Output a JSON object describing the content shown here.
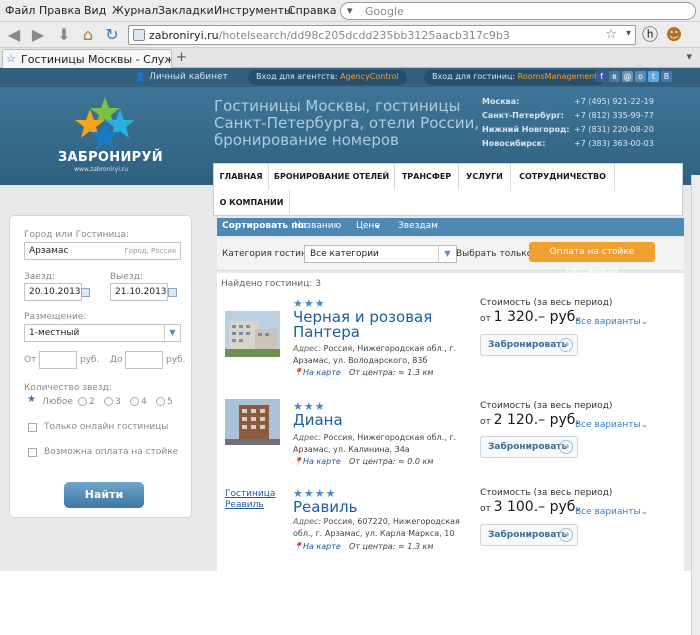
{
  "browser": {
    "menu": [
      "Файл",
      "Правка",
      "Вид",
      "Журнал",
      "Закладки",
      "Инструменты",
      "Справка"
    ],
    "search_placeholder": "Google",
    "url_domain": "zabroniryi.ru",
    "url_path": "/hotelsearch/dd98c205dcdd235bb3125aacb317c9b3",
    "tab_title": "Гостиницы Москвы - Служба б..."
  },
  "site": {
    "personal_cabinet": "Личный кабинет",
    "agents_label": "Вход для агентств:",
    "agents_link": "AgencyControl",
    "hotels_label": "Вход для гостиниц:",
    "hotels_link": "RoomsManagement",
    "brand": "ЗАБРОНИРУЙ",
    "brand_url": "www.zabroniryi.ru",
    "slogan": "Гостиницы Москвы, гостиницы Санкт-Петербурга, отели России, бронирование номеров",
    "phones": [
      {
        "city": "Москва:",
        "number": "+7 (495) 921-22-19"
      },
      {
        "city": "Санкт-Петербург:",
        "number": "+7 (812) 335-99-77"
      },
      {
        "city": "Нижний Новгород:",
        "number": "+7 (831) 220-08-20"
      },
      {
        "city": "Новосибирск:",
        "number": "+7 (383) 363-00-03"
      }
    ],
    "nav": [
      "ГЛАВНАЯ",
      "БРОНИРОВАНИЕ ОТЕЛЕЙ",
      "ТРАНСФЕР",
      "УСЛУГИ",
      "СОТРУДНИЧЕСТВО",
      "О КОМПАНИИ"
    ]
  },
  "sort": {
    "label": "Сортировать по:",
    "by_name": "Названию",
    "by_price": "Цене",
    "by_stars": "Звездам"
  },
  "filter": {
    "category_label": "Категория гостиниц:",
    "category_value": "Все категории",
    "only_label": "Выбрать только:",
    "pay_button": "Оплата на стойке гостиницы"
  },
  "search": {
    "city_label": "Город или Гостиница:",
    "city_value": "Арзамас",
    "city_hint": "Город, Россия",
    "checkin_label": "Заезд:",
    "checkin_value": "20.10.2013",
    "checkout_label": "Выезд:",
    "checkout_value": "21.10.2013",
    "room_label": "Размещение:",
    "room_value": "1-местный",
    "from_label": "От",
    "to_label": "До",
    "currency": "руб.",
    "stars_label": "Количество звезд:",
    "stars_any": "Любое",
    "stars_options": [
      "2",
      "3",
      "4",
      "5"
    ],
    "online_only": "Только онлайн гостиницы",
    "pay_at_desk": "Возможна оплата на стойке",
    "find_button": "Найти"
  },
  "results": {
    "found_label": "Найдено гостиниц:",
    "found_count": "3",
    "cost_label": "Стоимость (за весь период)",
    "from_word": "от",
    "variants_label": "Все варианты",
    "book_label": "Забронировать",
    "map_label": "На карте",
    "center_label": "От центра:",
    "address_label": "Адрес:",
    "hotels": [
      {
        "stars": "★★★",
        "name": "Черная и розовая Пантера",
        "address": "Россия, Нижегородская обл., г. Арзамас, ул. Володарского, 83б",
        "distance": "≈ 1.3 км",
        "price": "1 320.– руб."
      },
      {
        "stars": "★★★",
        "name": "Диана",
        "address": "Россия, Нижегородская обл., г. Арзамас, ул. Калинина, 34а",
        "distance": "≈ 0.0 км",
        "price": "2 120.– руб."
      },
      {
        "stars": "★★★★",
        "name": "Реавиль",
        "photo_link": "Гостиница Реавиль",
        "address": "Россия, 607220, Нижегородская обл., г. Арзамас, ул. Карла Маркса, 10",
        "distance": "≈ 1.3 км",
        "price": "3 100.– руб."
      }
    ]
  }
}
